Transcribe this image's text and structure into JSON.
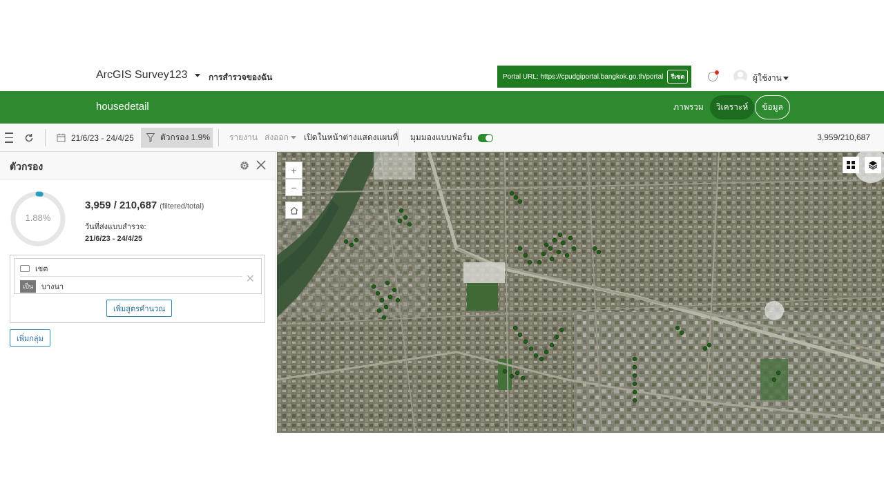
{
  "header": {
    "app_title": "ArcGIS Survey123",
    "my_surveys": "การสำรวจของฉัน",
    "portal_label": "Portal URL: https://cpudgiportal.bangkok.go.th/portal",
    "portal_reset": "รีเซต",
    "user_name": "ผู้ใช้งาน"
  },
  "nav": {
    "survey_name": "housedetail",
    "tabs": [
      "ภาพรวม",
      "วิเคราะห์",
      "ข้อมูล"
    ],
    "active_tab": "วิเคราะห์"
  },
  "toolbar": {
    "date_range": "21/6/23 - 24/4/25",
    "filter_label": "ตัวกรอง 1.9%",
    "report": "รายงาน",
    "export": "ส่งออก",
    "open_map": "เปิดในหน้าต่างแสดงแผนที่",
    "form_view": "มุมมองแบบฟอร์ม",
    "form_view_on": true,
    "record_count": "3,959/210,687"
  },
  "filter_panel": {
    "title": "ตัวกรอง",
    "percent_text": "1.88%",
    "percent_value": 1.88,
    "ratio": "3,959 / 210,687",
    "ratio_note": "(filtered/total)",
    "date_label": "วันที่ส่งแบบสำรวจ:",
    "date_value": "21/6/23 - 24/4/25",
    "condition": {
      "field": "เขต",
      "operator": "เป็น",
      "value": "บางนา"
    },
    "add_expression": "เพิ่มสูตรคำนวณ",
    "add_group": "เพิ่มกลุ่ม"
  },
  "map": {
    "zoom_in": "+",
    "zoom_out": "−"
  },
  "colors": {
    "brand_green": "#2e8a2e",
    "portal_green": "#1f7b20",
    "progress_teal": "#2a9bbf"
  }
}
